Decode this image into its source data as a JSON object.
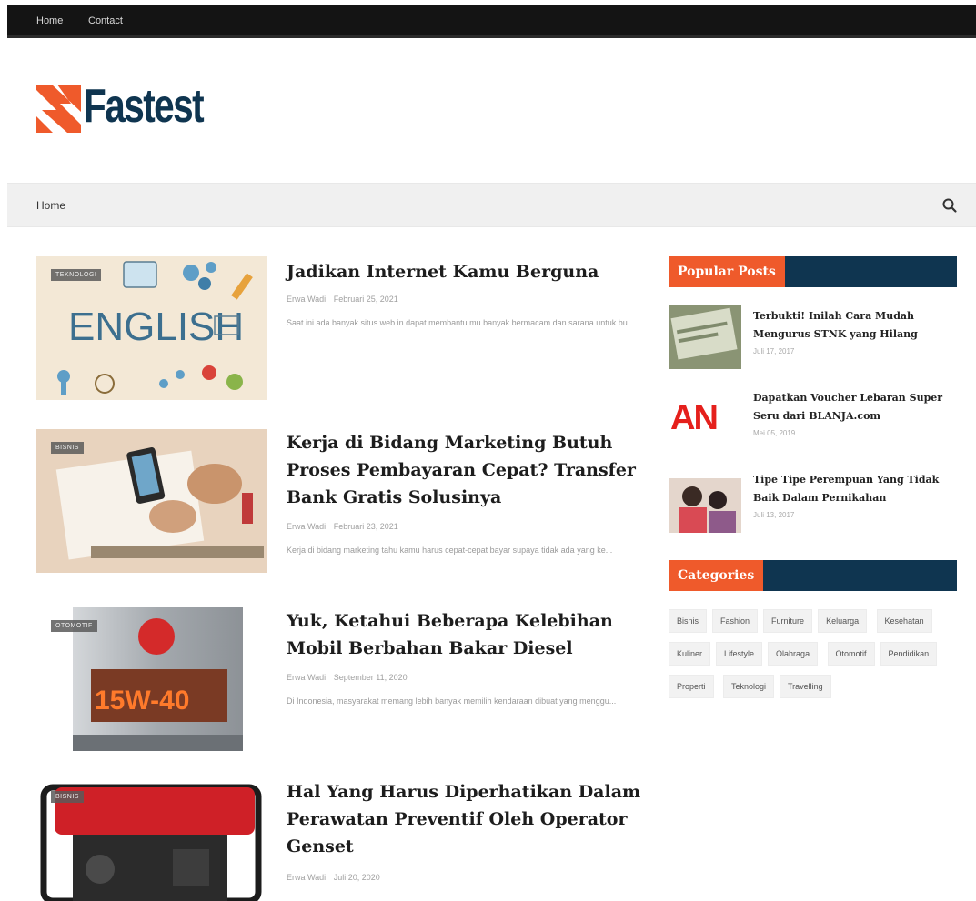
{
  "topbar": {
    "links": [
      "Home",
      "Contact"
    ]
  },
  "logo": {
    "text": "Fastest"
  },
  "nav": {
    "home": "Home",
    "search_icon": "search-icon"
  },
  "posts": [
    {
      "badge": "Teknologi",
      "title": "Jadikan Internet Kamu Berguna",
      "author": "Erwa Wadi",
      "date": "Februari 25, 2021",
      "excerpt": "Saat ini ada banyak situs web in dapat membantu mu banyak bermacam dan sarana untuk bu..."
    },
    {
      "badge": "Bisnis",
      "title": "Kerja di Bidang Marketing Butuh Proses Pembayaran Cepat? Transfer Bank Gratis Solusinya",
      "author": "Erwa Wadi",
      "date": "Februari 23, 2021",
      "excerpt": "Kerja di bidang marketing tahu kamu harus cepat-cepat bayar supaya tidak ada yang ke..."
    },
    {
      "badge": "Otomotif",
      "title": "Yuk, Ketahui Beberapa Kelebihan Mobil Berbahan Bakar Diesel",
      "author": "Erwa Wadi",
      "date": "September 11, 2020",
      "excerpt": "Di Indonesia, masyarakat memang lebih banyak memilih kendaraan dibuat yang menggu..."
    },
    {
      "badge": "Bisnis",
      "title": "Hal Yang Harus Diperhatikan Dalam Perawatan Preventif Oleh Operator Genset",
      "author": "Erwa Wadi",
      "date": "Juli 20, 2020",
      "excerpt": ""
    }
  ],
  "sidebar": {
    "popular_title": "Popular Posts",
    "popular": [
      {
        "title": "Terbukti! Inilah Cara Mudah Mengurus STNK yang Hilang",
        "date": "Juli 17, 2017"
      },
      {
        "title": "Dapatkan Voucher Lebaran Super Seru dari BLANJA.com",
        "date": "Mei 05, 2019",
        "thumb_text": "AN"
      },
      {
        "title": "Tipe Tipe Perempuan Yang Tidak Baik Dalam Pernikahan",
        "date": "Juli 13, 2017"
      }
    ],
    "categories_title": "Categories",
    "categories": [
      "Bisnis",
      "Fashion",
      "Furniture",
      "Keluarga",
      "Kesehatan",
      "Kuliner",
      "Lifestyle",
      "Olahraga",
      "Otomotif",
      "Pendidikan",
      "Properti",
      "Teknologi",
      "Travelling"
    ]
  },
  "colors": {
    "accent": "#ef5a2b",
    "brand": "#0f3550",
    "topbar": "#141414"
  },
  "thumb_texts": {
    "english": "ENGLISH",
    "oil": "15W-40"
  }
}
